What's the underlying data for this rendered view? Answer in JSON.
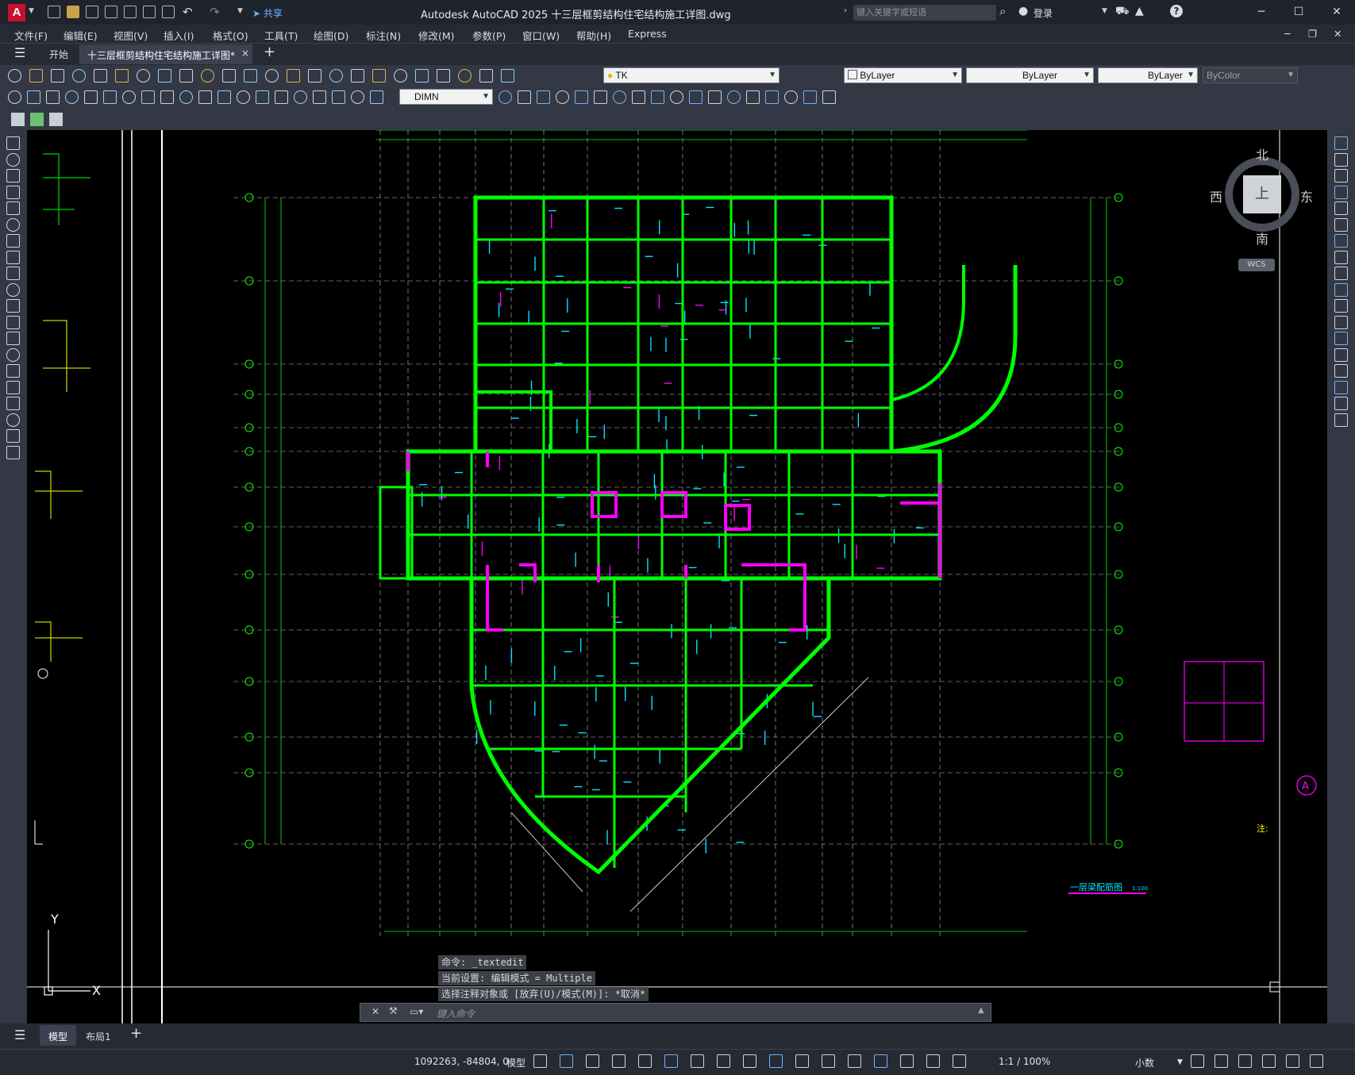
{
  "app": {
    "title": "Autodesk AutoCAD 2025    十三层框剪结构住宅结构施工详图.dwg",
    "logo": "A",
    "share_label": "共享",
    "search_placeholder": "键入关键字或短语",
    "login_label": "登录"
  },
  "menubar": {
    "items": [
      "文件(F)",
      "编辑(E)",
      "视图(V)",
      "插入(I)",
      "格式(O)",
      "工具(T)",
      "绘图(D)",
      "标注(N)",
      "修改(M)",
      "参数(P)",
      "窗口(W)",
      "帮助(H)",
      "Express"
    ]
  },
  "tabs": {
    "start_label": "开始",
    "document_label": "十三层框剪结构住宅结构施工详图*",
    "close_glyph": "×",
    "add_glyph": "+"
  },
  "toolbar": {
    "layer_value": "TK",
    "color_value": "ByLayer",
    "linetype_value": "ByLayer",
    "lineweight_value": "ByLayer",
    "plotstyle_value": "ByColor",
    "dimstyle_value": "DIMN"
  },
  "viewcube": {
    "north": "北",
    "south": "南",
    "east": "东",
    "west": "西",
    "face": "上",
    "wcs": "WCS"
  },
  "drawing": {
    "plan_title": "一层梁配筋图",
    "plan_scale": "1:100",
    "ucs_x": "X",
    "ucs_y": "Y",
    "note_label": "注:",
    "axis_marker": "A"
  },
  "command": {
    "history": [
      "命令: _textedit",
      "当前设置: 编辑模式 = Multiple",
      "选择注释对象或 [放弃(U)/模式(M)]: *取消*"
    ],
    "input_placeholder": "键入命令"
  },
  "layout_tabs": {
    "model": "模型",
    "layout1": "布局1",
    "add": "+"
  },
  "status": {
    "coordinates": "1092263, -84804, 0",
    "space": "模型",
    "annotation_scale": "1:1 / 100%",
    "units": "小数"
  },
  "colors": {
    "canvas": "#000000",
    "beam_green": "#00ff00",
    "rebar_cyan": "#00e5ff",
    "column_magenta": "#ff00ff",
    "axis_white": "#ffffff"
  }
}
